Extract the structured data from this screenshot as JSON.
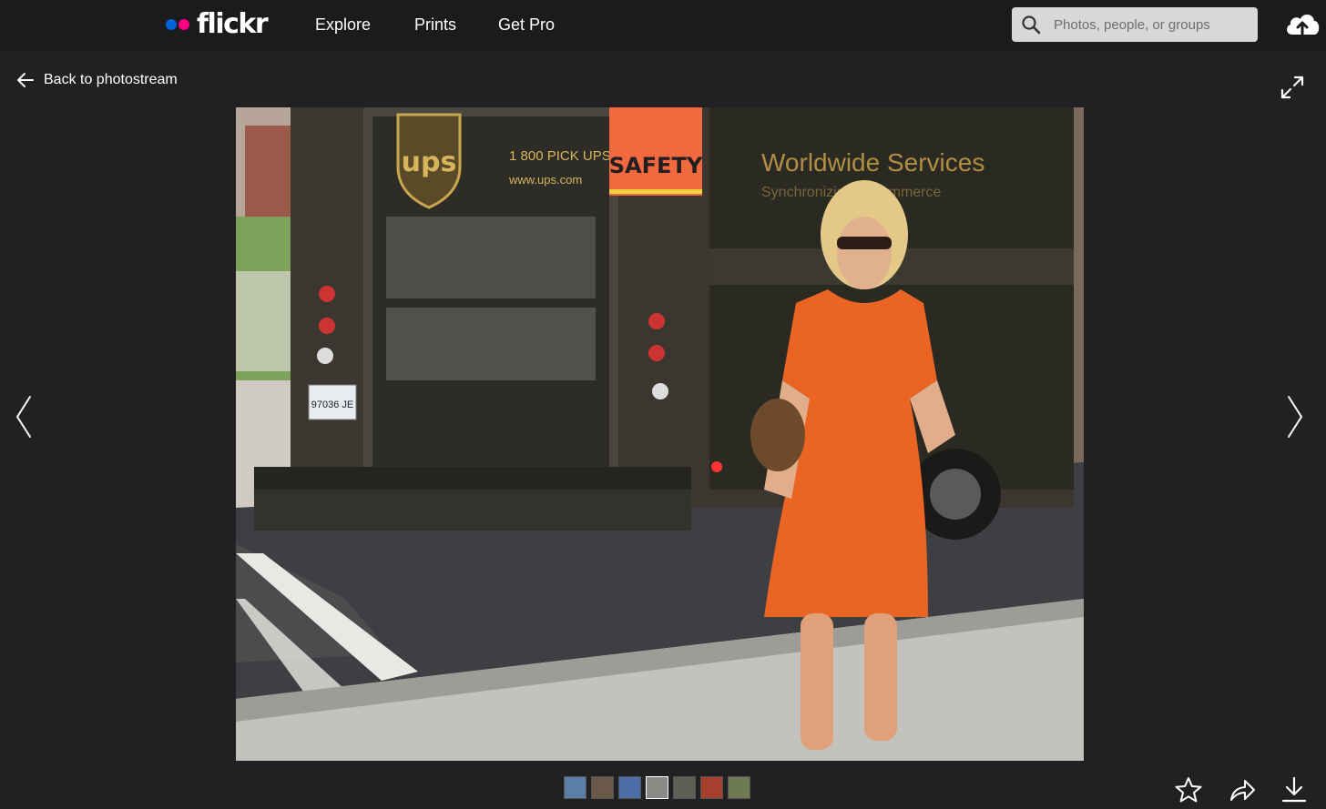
{
  "brand": {
    "name": "flickr",
    "blue": "#0063dc",
    "pink": "#ff0084"
  },
  "nav": {
    "explore": "Explore",
    "prints": "Prints",
    "get_pro": "Get Pro"
  },
  "search": {
    "placeholder": "Photos, people, or groups",
    "icon": "search-icon"
  },
  "toolbar": {
    "back_label": "Back to photostream",
    "upload_icon": "cloud-upload-icon",
    "expand_icon": "expand-icon"
  },
  "photo": {
    "truck_signs": {
      "brand": "ups",
      "phone": "1 800 PICK UPS",
      "web": "www.ups.com",
      "safety": "SAFETY",
      "slogan": "Worldwide Services",
      "slogan2": "Synchronizing ... commerce",
      "plate": "97036 JE"
    }
  },
  "filmstrip": {
    "thumbnails": [
      {
        "color": "#5a7fa6"
      },
      {
        "color": "#6a5848"
      },
      {
        "color": "#4b6ea8"
      },
      {
        "color": "#8a8a86",
        "active": true
      },
      {
        "color": "#5c5f54"
      },
      {
        "color": "#a5402c"
      },
      {
        "color": "#6f7a52"
      }
    ]
  },
  "actions": {
    "favorite_icon": "star-icon",
    "share_icon": "share-icon",
    "download_icon": "download-icon"
  }
}
